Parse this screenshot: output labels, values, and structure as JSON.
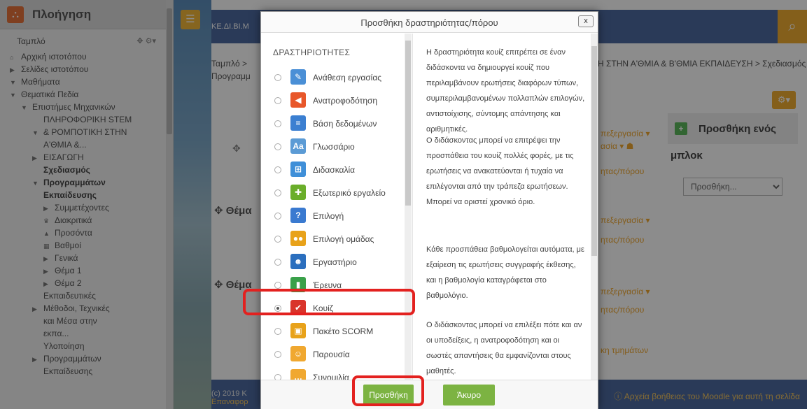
{
  "nav": {
    "title": "Πλοήγηση",
    "items": [
      {
        "label": "Ταμπλό",
        "level": 0,
        "twisty": "",
        "bold": false
      },
      {
        "label": "Αρχική ιστοτόπου",
        "level": 0,
        "twisty": "home",
        "bold": false
      },
      {
        "label": "Σελίδες ιστοτόπου",
        "level": 0,
        "twisty": "closed",
        "bold": false
      },
      {
        "label": "Μαθήματα",
        "level": 0,
        "twisty": "open",
        "bold": false
      },
      {
        "label": "Θεματικά Πεδία",
        "level": 1,
        "twisty": "open",
        "bold": false
      },
      {
        "label": "Επιστήμες Μηχανικών",
        "level": 2,
        "twisty": "open",
        "bold": false
      },
      {
        "label": "ΠΛΗΡΟΦΟΡΙΚΗ STEM",
        "level": 3,
        "twisty": "",
        "bold": false
      },
      {
        "label": "& ΡΟΜΠΟΤΙΚΗ ΣΤΗΝ",
        "level": 3,
        "twisty": "open",
        "bold": false
      },
      {
        "label": "Α'ΘΜΙΑ &...",
        "level": 3,
        "twisty": "",
        "bold": false
      },
      {
        "label": "ΕΙΣΑΓΩΓΗ",
        "level": 3,
        "twisty": "closed",
        "bold": false
      },
      {
        "label": "Σχεδιασμός",
        "level": 3,
        "twisty": "",
        "bold": true
      },
      {
        "label": "Προγραμμάτων",
        "level": 3,
        "twisty": "open",
        "bold": true
      },
      {
        "label": "Εκπαίδευσης",
        "level": 3,
        "twisty": "",
        "bold": true
      },
      {
        "label": "Συμμετέχοντες",
        "level": 4,
        "twisty": "closed",
        "bold": false
      },
      {
        "label": "Διακριτικά",
        "level": 4,
        "twisty": "trophy",
        "bold": false
      },
      {
        "label": "Προσόντα",
        "level": 4,
        "twisty": "grad",
        "bold": false
      },
      {
        "label": "Βαθμοί",
        "level": 4,
        "twisty": "grid",
        "bold": false
      },
      {
        "label": "Γενικά",
        "level": 4,
        "twisty": "closed",
        "bold": false
      },
      {
        "label": "Θέμα 1",
        "level": 4,
        "twisty": "closed",
        "bold": false
      },
      {
        "label": "Θέμα 2",
        "level": 4,
        "twisty": "closed",
        "bold": false
      },
      {
        "label": "Εκπαιδευτικές",
        "level": 3,
        "twisty": "",
        "bold": false
      },
      {
        "label": "Μέθοδοι, Τεχνικές",
        "level": 3,
        "twisty": "closed",
        "bold": false
      },
      {
        "label": "και Μέσα στην",
        "level": 3,
        "twisty": "",
        "bold": false
      },
      {
        "label": "εκπα...",
        "level": 3,
        "twisty": "",
        "bold": false
      },
      {
        "label": "Υλοποίηση",
        "level": 3,
        "twisty": "",
        "bold": false
      },
      {
        "label": "Προγραμμάτων",
        "level": 3,
        "twisty": "closed",
        "bold": false
      },
      {
        "label": "Εκπαίδευσης",
        "level": 3,
        "twisty": "",
        "bold": false
      }
    ]
  },
  "page": {
    "site_label": "ΚΕ.ΔΙ.ΒΙ.Μ",
    "crumb_start": "Ταμπλό >",
    "crumb_second": "Προγραμμ",
    "crumb_right": "Η ΣΤΗΝ Α'ΘΜΙΑ & Β'ΘΜΙΑ ΕΚΠΑΙΔΕΥΣΗ > Σχεδιασμός",
    "topic_label": "Θέμα",
    "edit_label": "πεξεργασία",
    "add_activity_label": "ητας/πόρου",
    "section_edit_label": "ασία",
    "block_sections_label": "κη τμημάτων",
    "block_title_1": "Προσθήκη ενός",
    "block_title_2": "μπλοκ",
    "block_select": "Προσθήκη...",
    "footer_copy": "(c) 2019 Κ",
    "footer_link": "Επαναφορ",
    "footer_help": "Αρχεία βοήθειας του Moodle για αυτή τη σελίδα"
  },
  "dialog": {
    "title": "Προσθήκη δραστηριότητας/πόρου",
    "close_label": "x",
    "list_heading": "ΔΡΑΣΤΗΡΙΟΤΗΤΕΣ",
    "options": [
      {
        "label": "Ανάθεση εργασίας",
        "icon": "assignment-icon",
        "color": "#4a8fd6",
        "glyph": "✎",
        "selected": false
      },
      {
        "label": "Ανατροφοδότηση",
        "icon": "feedback-icon",
        "color": "#e8572a",
        "glyph": "◀",
        "selected": false
      },
      {
        "label": "Βάση δεδομένων",
        "icon": "database-icon",
        "color": "#3b7fd1",
        "glyph": "≡",
        "selected": false
      },
      {
        "label": "Γλωσσάριο",
        "icon": "glossary-icon",
        "color": "#5b9bd5",
        "glyph": "Aa",
        "selected": false
      },
      {
        "label": "Διδασκαλία",
        "icon": "lesson-icon",
        "color": "#3f8fd8",
        "glyph": "⊞",
        "selected": false
      },
      {
        "label": "Εξωτερικό εργαλείο",
        "icon": "external-tool-icon",
        "color": "#6aae2a",
        "glyph": "✚",
        "selected": false
      },
      {
        "label": "Επιλογή",
        "icon": "choice-icon",
        "color": "#3a7ad0",
        "glyph": "?",
        "selected": false
      },
      {
        "label": "Επιλογή ομάδας",
        "icon": "group-choice-icon",
        "color": "#e8a21a",
        "glyph": "●●",
        "selected": false
      },
      {
        "label": "Εργαστήριο",
        "icon": "workshop-icon",
        "color": "#2b6fbe",
        "glyph": "☻",
        "selected": false
      },
      {
        "label": "Έρευνα",
        "icon": "survey-icon",
        "color": "#3aa14a",
        "glyph": "▮",
        "selected": false
      },
      {
        "label": "Κουίζ",
        "icon": "quiz-icon",
        "color": "#d9342b",
        "glyph": "✔",
        "selected": true
      },
      {
        "label": "Πακέτο SCORM",
        "icon": "scorm-icon",
        "color": "#e8a21a",
        "glyph": "▣",
        "selected": false
      },
      {
        "label": "Παρουσία",
        "icon": "attendance-icon",
        "color": "#f0a830",
        "glyph": "☺",
        "selected": false
      },
      {
        "label": "Συνομιλία",
        "icon": "chat-icon",
        "color": "#f0a830",
        "glyph": "…",
        "selected": false
      }
    ],
    "description": [
      "Η δραστηριότητα κουίζ επιτρέπει σε έναν διδάσκοντα να δημιουργεί κουίζ που περιλαμβάνουν ερωτήσεις διαφόρων τύπων, συμπεριλαμβανομένων πολλαπλών επιλογών, αντιστοίχισης, σύντομης απάντησης και αριθμητικές.",
      "Ο διδάσκοντας μπορεί να επιτρέψει την προσπάθεια του κουίζ πολλές φορές, με τις ερωτήσεις να ανακατεύονται ή τυχαία να επιλέγονται από την τράπεζα ερωτήσεων. Μπορεί να οριστεί χρονικό όριο.",
      "Κάθε προσπάθεια βαθμολογείται αυτόματα, με εξαίρεση τις ερωτήσεις συγγραφής έκθεσης, και η βαθμολογία καταγράφεται στο βαθμολόγιο.",
      "Ο διδάσκοντας μπορεί να επιλέξει πότε και αν οι υποδείξεις, η ανατροφοδότηση και οι σωστές απαντήσεις θα εμφανίζονται στους μαθητές."
    ],
    "add_button": "Προσθήκη",
    "cancel_button": "Άκυρο"
  }
}
